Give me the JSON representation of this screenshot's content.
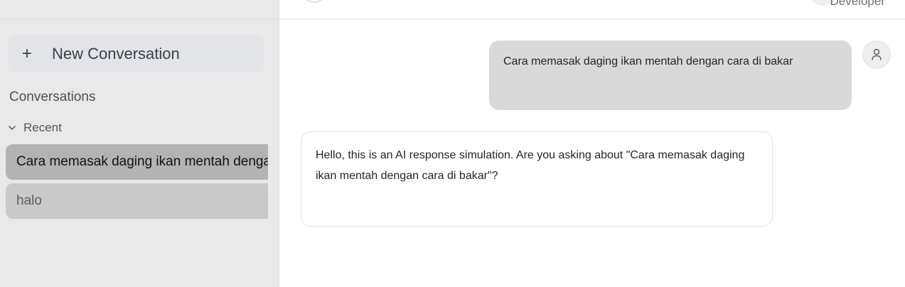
{
  "sidebar": {
    "new_conversation_label": "New Conversation",
    "new_conversation_icon": "plus-icon",
    "section_title": "Conversations",
    "recent_label": "Recent",
    "conversations": [
      {
        "title": "Cara memasak daging ikan mentah dengan cara di bakar",
        "active": true
      },
      {
        "title": "halo",
        "active": false
      }
    ]
  },
  "topbar": {
    "user_role": "Developer"
  },
  "chat": {
    "messages": [
      {
        "role": "user",
        "text": "Cara memasak daging ikan mentah dengan cara di bakar"
      },
      {
        "role": "assistant",
        "text": "Hello, this is an AI response simulation. Are you asking about \"Cara memasak daging ikan mentah dengan cara di bakar\"?"
      }
    ]
  },
  "colors": {
    "sidebar_bg": "#e9e9e9",
    "active_item_bg": "#b3b3b3",
    "inactive_item_bg": "#c9c9c9",
    "user_bubble_bg": "#d9d9d9"
  }
}
